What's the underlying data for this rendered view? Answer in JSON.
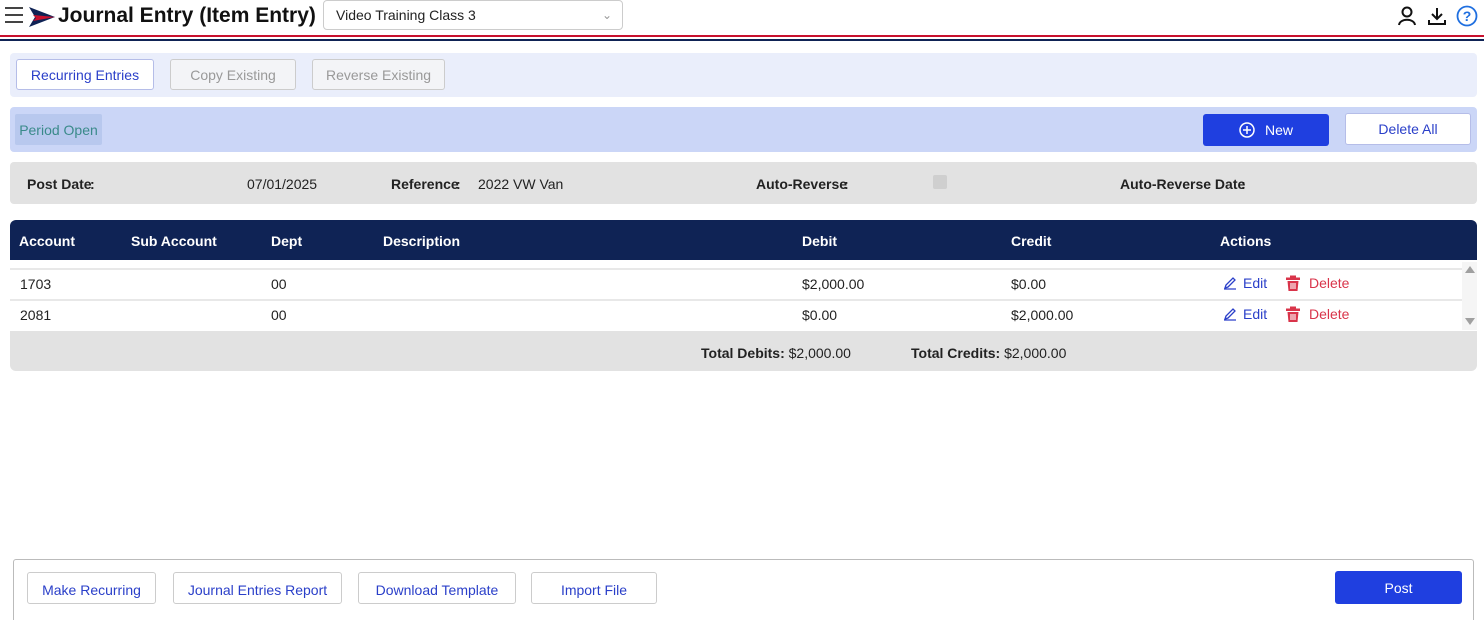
{
  "header": {
    "title": "Journal Entry (Item Entry)",
    "company": "Video Training Class 3",
    "colors": {
      "navy": "#0f2355",
      "red": "#c8102e",
      "accent_blue": "#1f3fe0"
    }
  },
  "toolbar": {
    "recurring": "Recurring Entries",
    "copy": "Copy Existing",
    "reverse": "Reverse Existing"
  },
  "period": {
    "status": "Period Open",
    "new_label": "New",
    "delete_all_label": "Delete All"
  },
  "info": {
    "post_date_label": "Post Date",
    "post_date": "07/01/2025",
    "reference_label": "Reference",
    "reference": "2022 VW Van",
    "auto_reverse_label": "Auto-Reverse",
    "auto_reverse_checked": false,
    "auto_reverse_date_label": "Auto-Reverse Date"
  },
  "table": {
    "columns": [
      "Account",
      "Sub Account",
      "Dept",
      "Description",
      "Debit",
      "Credit",
      "Actions"
    ],
    "rows": [
      {
        "account": "1703",
        "sub_account": "",
        "dept": "00",
        "description": "",
        "debit": "$2,000.00",
        "credit": "$0.00",
        "edit": "Edit",
        "delete": "Delete"
      },
      {
        "account": "2081",
        "sub_account": "",
        "dept": "00",
        "description": "",
        "debit": "$0.00",
        "credit": "$2,000.00",
        "edit": "Edit",
        "delete": "Delete"
      }
    ]
  },
  "totals": {
    "debits_label": "Total Debits:",
    "debits": "$2,000.00",
    "credits_label": "Total Credits:",
    "credits": "$2,000.00"
  },
  "footer": {
    "make_recurring": "Make Recurring",
    "report": "Journal Entries Report",
    "download": "Download Template",
    "import": "Import File",
    "post": "Post"
  }
}
